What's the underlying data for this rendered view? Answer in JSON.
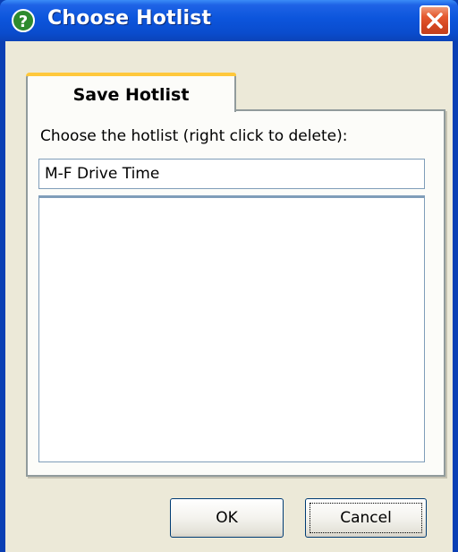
{
  "window": {
    "title": "Choose Hotlist",
    "icon": "help-question-icon",
    "close_icon": "close-icon"
  },
  "tab": {
    "label": "Save Hotlist"
  },
  "form": {
    "prompt": "Choose the hotlist (right click to delete):",
    "hotlist_name_value": "M-F Drive Time",
    "hotlist_items": []
  },
  "buttons": {
    "ok_label": "OK",
    "cancel_label": "Cancel"
  },
  "colors": {
    "titlebar": "#0a4ccd",
    "close_button": "#e5592f",
    "dialog_face": "#ece9d8",
    "tab_highlight": "#ffc83c"
  }
}
